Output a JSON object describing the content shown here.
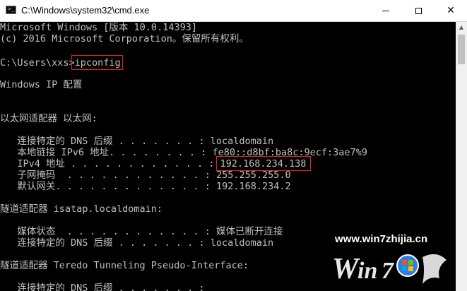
{
  "window": {
    "title": "C:\\Windows\\system32\\cmd.exe",
    "icon": "cmd-icon",
    "controls": {
      "minimize": "minimize-icon",
      "maximize": "maximize-icon",
      "close": "close-icon",
      "close_glyph": "✕"
    }
  },
  "console": {
    "lines": [
      "Microsoft Windows [版本 10.0.14393]",
      "(c) 2016 Microsoft Corporation。保留所有权利。",
      "",
      "C:\\Users\\xxs>ipconfig",
      "",
      "Windows IP 配置",
      "",
      "",
      "以太网适配器 以太网:",
      "",
      "   连接特定的 DNS 后缀 . . . . . . . : localdomain",
      "   本地链接 IPv6 地址. . . . . . . . : fe80::d8bf:ba8c:9ecf:3ae7%9",
      "   IPv4 地址 . . . . . . . . . . . . : 192.168.234.138",
      "   子网掩码  . . . . . . . . . . . . : 255.255.255.0",
      "   默认网关. . . . . . . . . . . . . : 192.168.234.2",
      "",
      "隧道适配器 isatap.localdomain:",
      "",
      "   媒体状态  . . . . . . . . . . . . : 媒体已断开连接",
      "   连接特定的 DNS 后缀 . . . . . . . : localdomain",
      "",
      "隧道适配器 Teredo Tunneling Pseudo-Interface:",
      "",
      "   连接特定的 DNS 后缀 . . . . . . . :"
    ]
  },
  "scrollbar": {
    "up_glyph": "▲"
  },
  "watermark": {
    "url": "www.win7zhijia.cn"
  }
}
